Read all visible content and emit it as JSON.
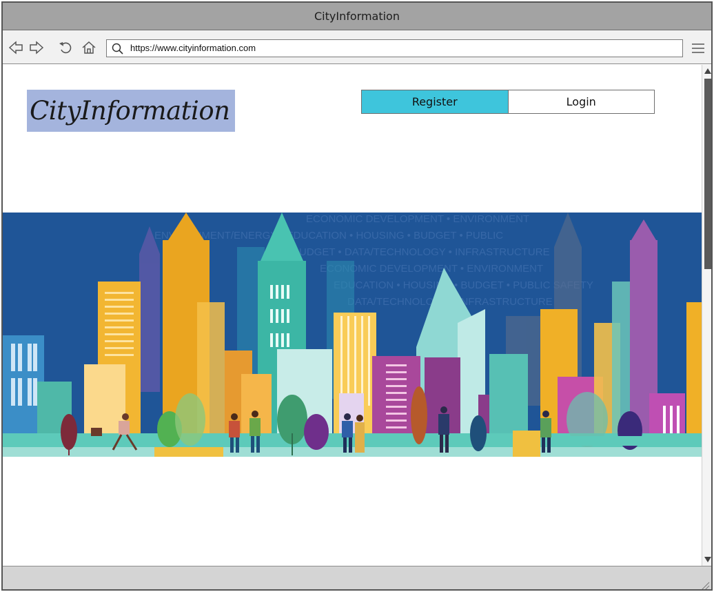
{
  "window": {
    "title": "CityInformation"
  },
  "browser": {
    "url": "https://www.cityinformation.com",
    "icons": [
      "back-icon",
      "forward-icon",
      "reload-icon",
      "home-icon",
      "search-icon",
      "hamburger-menu-icon"
    ]
  },
  "header": {
    "logo_text": "CityInformation",
    "register_label": "Register",
    "login_label": "Login"
  },
  "hero": {
    "description_icon": "city-skyline-illustration",
    "background_text_lines": [
      "ECONOMIC DEVELOPMENT • ENVIRONMENT",
      "ENVIRONMENT/ENERGY • EDUCATION • HOUSING • BUDGET • PUBLIC",
      "BUDGET • DATA/TECHNOLOGY • INFRASTRUCTURE",
      "ECONOMIC DEVELOPMENT • ENVIRONMENT",
      "EDUCATION • HOUSING • BUDGET • PUBLIC SAFETY",
      "DATA/TECHNOLOGY • INFRASTRUCTURE"
    ]
  },
  "colors": {
    "titlebar": "#a3a3a3",
    "logo_bg": "#a4b4dd",
    "register_bg": "#3ec5dc",
    "hero_sky": "#1f5597"
  }
}
